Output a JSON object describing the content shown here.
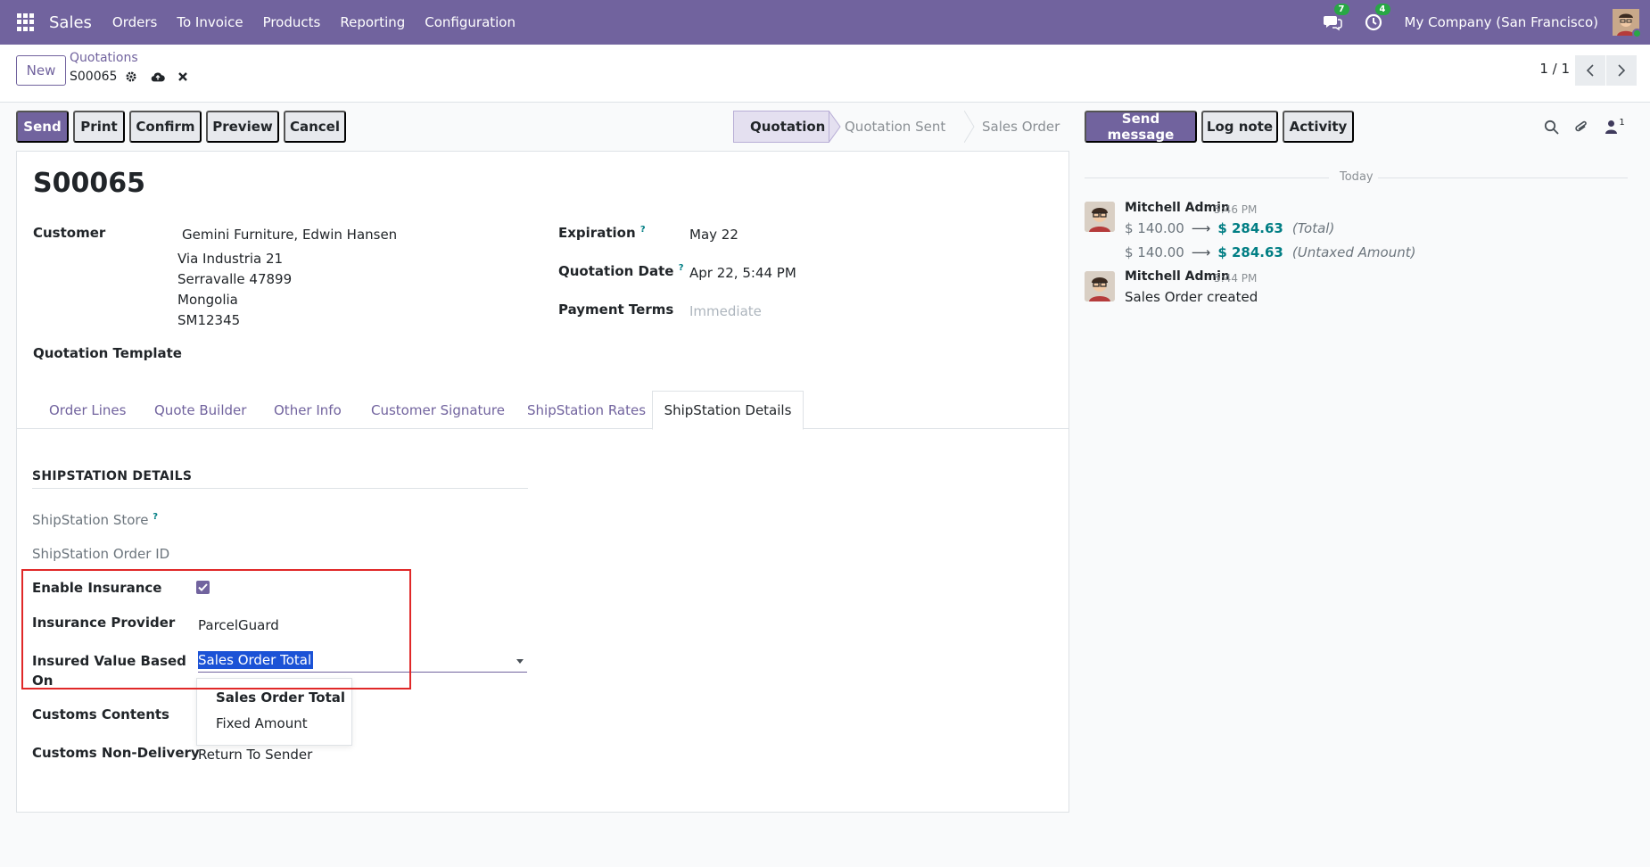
{
  "navbar": {
    "app_name": "Sales",
    "menu": [
      "Orders",
      "To Invoice",
      "Products",
      "Reporting",
      "Configuration"
    ],
    "messages_count": "7",
    "activities_count": "4",
    "company": "My Company (San Francisco)"
  },
  "control": {
    "new_label": "New",
    "breadcrumb": "Quotations",
    "record": "S00065",
    "pager": "1 / 1"
  },
  "actions": {
    "send": "Send",
    "print": "Print",
    "confirm": "Confirm",
    "preview": "Preview",
    "cancel": "Cancel"
  },
  "status": {
    "stages": [
      "Quotation",
      "Quotation Sent",
      "Sales Order"
    ],
    "active": "Quotation"
  },
  "form": {
    "title": "S00065",
    "customer_label": "Customer",
    "customer_name": "Gemini Furniture, Edwin Hansen",
    "address": [
      "Via Industria 21",
      "Serravalle 47899",
      "Mongolia",
      "SM12345"
    ],
    "expiration_label": "Expiration",
    "expiration": "May 22",
    "quotation_date_label": "Quotation Date",
    "quotation_date": "Apr 22, 5:44 PM",
    "payment_terms_label": "Payment Terms",
    "payment_terms_placeholder": "Immediate",
    "template_label": "Quotation Template",
    "help_mark": "?"
  },
  "tabs": [
    "Order Lines",
    "Quote Builder",
    "Other Info",
    "Customer Signature",
    "ShipStation Rates",
    "ShipStation Details"
  ],
  "shipstation": {
    "section_title": "SHIPSTATION DETAILS",
    "store_label": "ShipStation Store",
    "order_id_label": "ShipStation Order ID",
    "enable_insurance_label": "Enable Insurance",
    "enable_insurance": true,
    "provider_label": "Insurance Provider",
    "provider": "ParcelGuard",
    "insured_value_label_1": "Insured Value Based",
    "insured_value_label_2": "On",
    "insured_value": "Sales Order Total",
    "options": [
      "Sales Order Total",
      "Fixed Amount"
    ],
    "customs_contents_label": "Customs Contents",
    "customs_nondelivery_label": "Customs Non-Delivery",
    "customs_nondelivery": "Return To Sender"
  },
  "chatter": {
    "send_message": "Send message",
    "log_note": "Log note",
    "activity": "Activity",
    "followers_count": "1",
    "today": "Today",
    "messages": [
      {
        "author": "Mitchell Admin",
        "time": "5:46 PM",
        "tracking": [
          {
            "old": "$ 140.00",
            "new": "$ 284.63",
            "field": "(Total)"
          },
          {
            "old": "$ 140.00",
            "new": "$ 284.63",
            "field": "(Untaxed Amount)"
          }
        ]
      },
      {
        "author": "Mitchell Admin",
        "time": "5:44 PM",
        "body": "Sales Order created"
      }
    ]
  },
  "colors": {
    "brand": "#71639e",
    "accent_teal": "#017e84",
    "highlight_red": "#e02828",
    "selection_blue": "#1b52d6"
  }
}
